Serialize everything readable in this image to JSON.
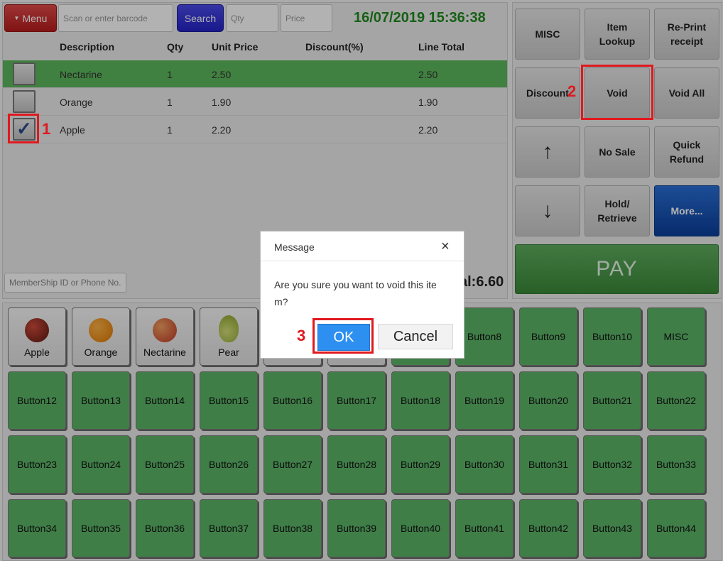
{
  "toolbar": {
    "menu_label": "Menu",
    "barcode_placeholder": "Scan or enter barcode",
    "search_label": "Search",
    "qty_placeholder": "Qty",
    "price_placeholder": "Price",
    "datetime": "16/07/2019 15:36:38"
  },
  "table": {
    "headers": [
      "Description",
      "Qty",
      "Unit Price",
      "Discount(%)",
      "Line Total"
    ],
    "rows": [
      {
        "description": "Nectarine",
        "qty": "1",
        "unit_price": "2.50",
        "discount": "",
        "line_total": "2.50",
        "checked": false,
        "highlighted": true
      },
      {
        "description": "Orange",
        "qty": "1",
        "unit_price": "1.90",
        "discount": "",
        "line_total": "1.90",
        "checked": false,
        "highlighted": false
      },
      {
        "description": "Apple",
        "qty": "1",
        "unit_price": "2.20",
        "discount": "",
        "line_total": "2.20",
        "checked": true,
        "highlighted": false
      }
    ]
  },
  "membership_placeholder": "MemberShip ID or Phone No.",
  "total_text": "al:6.60",
  "functions": {
    "misc": "MISC",
    "item_lookup": "Item\nLookup",
    "reprint": "Re-Print\nreceipt",
    "discount": "Discount",
    "void": "Void",
    "void_all": "Void All",
    "up_arrow": "↑",
    "no_sale": "No Sale",
    "quick_refund": "Quick\nRefund",
    "down_arrow": "↓",
    "hold_retrieve": "Hold/\nRetrieve",
    "more": "More...",
    "pay": "PAY"
  },
  "products": {
    "fruit": [
      "Apple",
      "Orange",
      "Nectarine",
      "Pear"
    ],
    "row1_green": [
      "Button8",
      "Button9",
      "Button10",
      "MISC"
    ],
    "row2": [
      "Button12",
      "Button13",
      "Button14",
      "Button15",
      "Button16",
      "Button17",
      "Button18",
      "Button19",
      "Button20",
      "Button21",
      "Button22"
    ],
    "row3": [
      "Button23",
      "Button24",
      "Button25",
      "Button26",
      "Button27",
      "Button28",
      "Button29",
      "Button30",
      "Button31",
      "Button32",
      "Button33"
    ],
    "row4": [
      "Button34",
      "Button35",
      "Button36",
      "Button37",
      "Button38",
      "Button39",
      "Button40",
      "Button41",
      "Button42",
      "Button43",
      "Button44"
    ]
  },
  "dialog": {
    "title": "Message",
    "close": "×",
    "message": "Are you sure you want to void this ite m?",
    "ok": "OK",
    "cancel": "Cancel"
  },
  "annotations": [
    "1",
    "2",
    "3"
  ],
  "colors": {
    "highlight_row": "#5cb85c",
    "product_button": "#5cb567",
    "annotation_red": "#e0191f",
    "datetime_green": "#1f8a1f",
    "ok_blue": "#2d8ff0"
  }
}
